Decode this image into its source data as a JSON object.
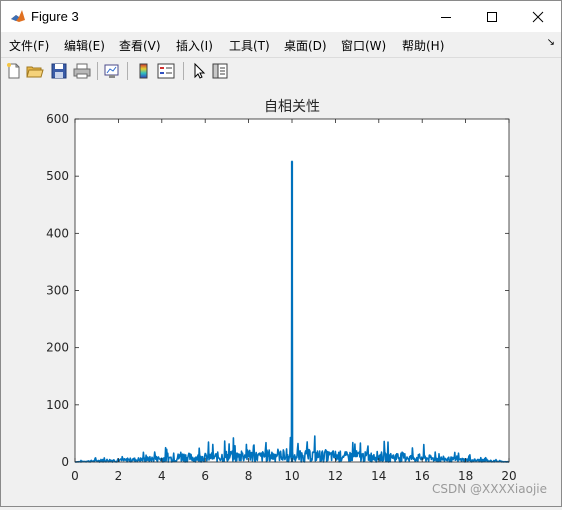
{
  "window": {
    "title": "Figure 3"
  },
  "menu": {
    "items": [
      "文件(F)",
      "编辑(E)",
      "查看(V)",
      "插入(I)",
      "工具(T)",
      "桌面(D)",
      "窗口(W)",
      "帮助(H)"
    ]
  },
  "toolbar": {
    "icons": [
      "new-file-icon",
      "open-folder-icon",
      "save-icon",
      "print-icon",
      "link-plot-icon",
      "colorbar-icon",
      "legend-icon",
      "pointer-icon",
      "property-editor-icon"
    ]
  },
  "chart_data": {
    "type": "line",
    "title": "自相关性",
    "xlabel": "",
    "ylabel": "",
    "xlim": [
      0,
      20
    ],
    "ylim": [
      0,
      600
    ],
    "xticks": [
      "0",
      "2",
      "4",
      "6",
      "8",
      "10",
      "12",
      "14",
      "16",
      "18",
      "20"
    ],
    "yticks": [
      "0",
      "100",
      "200",
      "300",
      "400",
      "500",
      "600"
    ],
    "line_color": "#0072bd",
    "grid": false,
    "peak": {
      "x": 10,
      "y": 526
    },
    "x": [
      0,
      0.5,
      1.0,
      1.5,
      2.0,
      2.5,
      3.0,
      3.5,
      4.0,
      4.5,
      5.0,
      5.5,
      6.0,
      6.5,
      7.0,
      7.5,
      8.0,
      8.5,
      9.0,
      9.5,
      9.9,
      10.0,
      10.1,
      10.5,
      11.0,
      11.5,
      12.0,
      12.5,
      13.0,
      13.5,
      14.0,
      14.5,
      15.0,
      15.5,
      16.0,
      16.5,
      17.0,
      17.5,
      18.0,
      18.5,
      19.0,
      19.5,
      20.0
    ],
    "y": [
      0,
      5,
      8,
      12,
      10,
      15,
      18,
      22,
      25,
      28,
      40,
      30,
      35,
      38,
      45,
      42,
      48,
      40,
      50,
      45,
      30,
      526,
      30,
      48,
      50,
      44,
      46,
      40,
      45,
      38,
      42,
      35,
      40,
      30,
      32,
      25,
      22,
      18,
      15,
      12,
      8,
      5,
      0
    ]
  },
  "watermark": "CSDN @XXXXiaojie"
}
